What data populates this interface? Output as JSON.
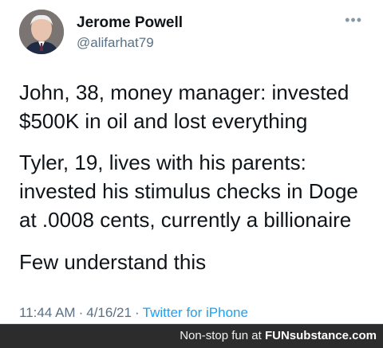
{
  "author": {
    "name": "Jerome Powell",
    "handle": "@alifarhat79",
    "avatar_icon": "portrait-avatar"
  },
  "more_icon": "ellipsis-icon",
  "tweet": {
    "paragraph1": "John, 38, money manager: invested\n$500K in oil and lost everything",
    "paragraph2": "Tyler, 19, lives with his parents:\ninvested his stimulus checks in Doge\nat .0008 cents, currently a billionaire",
    "paragraph3": "Few understand this"
  },
  "meta": {
    "time": "11:44 AM",
    "separator": "·",
    "date": "4/16/21",
    "source": "Twitter for iPhone"
  },
  "footer": {
    "tagline": "Non-stop fun at ",
    "brand_prefix": "FUN",
    "brand_suffix": "substance.com"
  },
  "colors": {
    "link": "#1da1f2",
    "muted": "#5b7083",
    "footer_bg": "#2c2c2c"
  }
}
